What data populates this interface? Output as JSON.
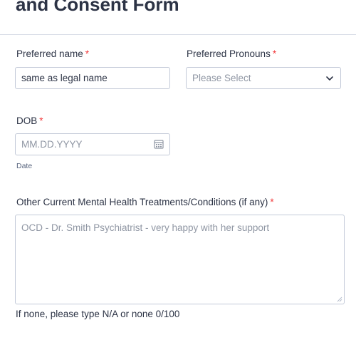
{
  "form": {
    "title": "and Consent Form"
  },
  "preferred_name": {
    "label": "Preferred name",
    "required_mark": "*",
    "value": "same as legal name"
  },
  "preferred_pronouns": {
    "label": "Preferred Pronouns",
    "required_mark": "*",
    "placeholder": "Please Select"
  },
  "dob": {
    "label": "DOB",
    "required_mark": "*",
    "placeholder": "MM.DD.YYYY",
    "sublabel": "Date",
    "icon": "calendar-icon"
  },
  "treatments": {
    "label": "Other Current Mental Health Treatments/Conditions (if any)",
    "required_mark": "*",
    "placeholder": "OCD - Dr. Smith Psychiatrist - very happy with her support",
    "helper": "If none, please type N/A or none 0/100"
  },
  "colors": {
    "required": "#f23a3c",
    "text": "#2c3345",
    "placeholder": "#8f96a3",
    "border": "#c3cad8"
  }
}
